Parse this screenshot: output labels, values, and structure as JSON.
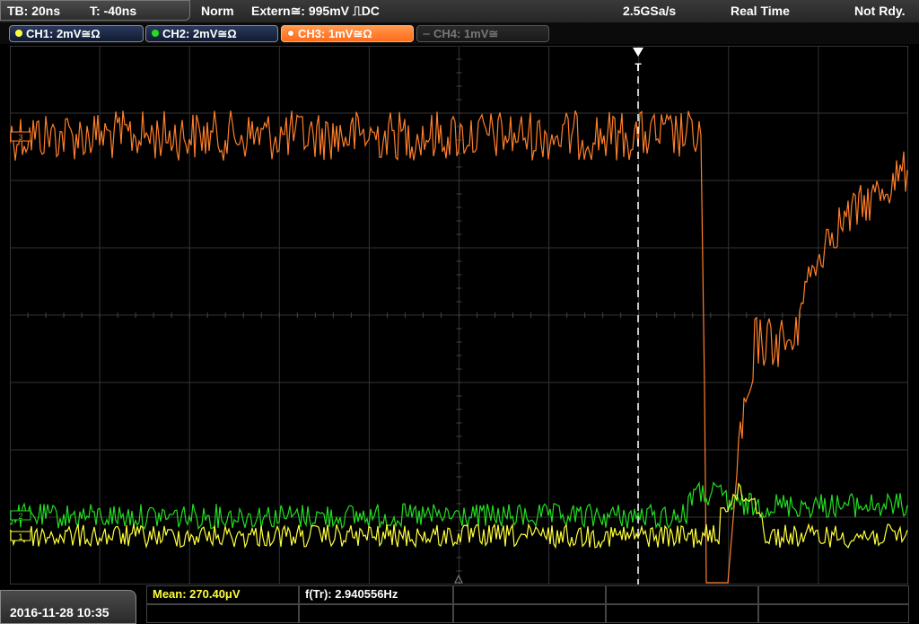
{
  "topbar": {
    "timebase": "TB: 20ns",
    "trigger_time": "T: -40ns",
    "trigger_mode": "Norm",
    "trigger_source": "Extern≅: 995mV ⎍DC",
    "sample_rate": "2.5GSa/s",
    "acq_mode": "Real Time",
    "status": "Not Rdy."
  },
  "channels": [
    {
      "label": "CH1: 2mV≅Ω",
      "color": "#ffff3a",
      "state": "on"
    },
    {
      "label": "CH2: 2mV≅Ω",
      "color": "#22dd22",
      "state": "on"
    },
    {
      "label": "CH3: 1mV≅Ω",
      "color": "#ff7f2a",
      "state": "active"
    },
    {
      "label": "CH4: 1mV≅",
      "color": "#666666",
      "state": "off"
    }
  ],
  "markers": {
    "ch3": "3",
    "ch2": "2",
    "ch1": "1",
    "trigger": "T"
  },
  "footer": {
    "datetime": "2016-11-28 10:35",
    "measurements": [
      {
        "label": "Mean: 270.40μV",
        "color": "#ffff3a"
      },
      {
        "label": "f(Tr): 2.940556Hz",
        "color": "#ffffff"
      }
    ]
  },
  "colors": {
    "ch1": "#ffff3a",
    "ch2": "#22dd22",
    "ch3": "#ff7f2a",
    "grid": "#3a3a3a",
    "background": "#000000"
  }
}
